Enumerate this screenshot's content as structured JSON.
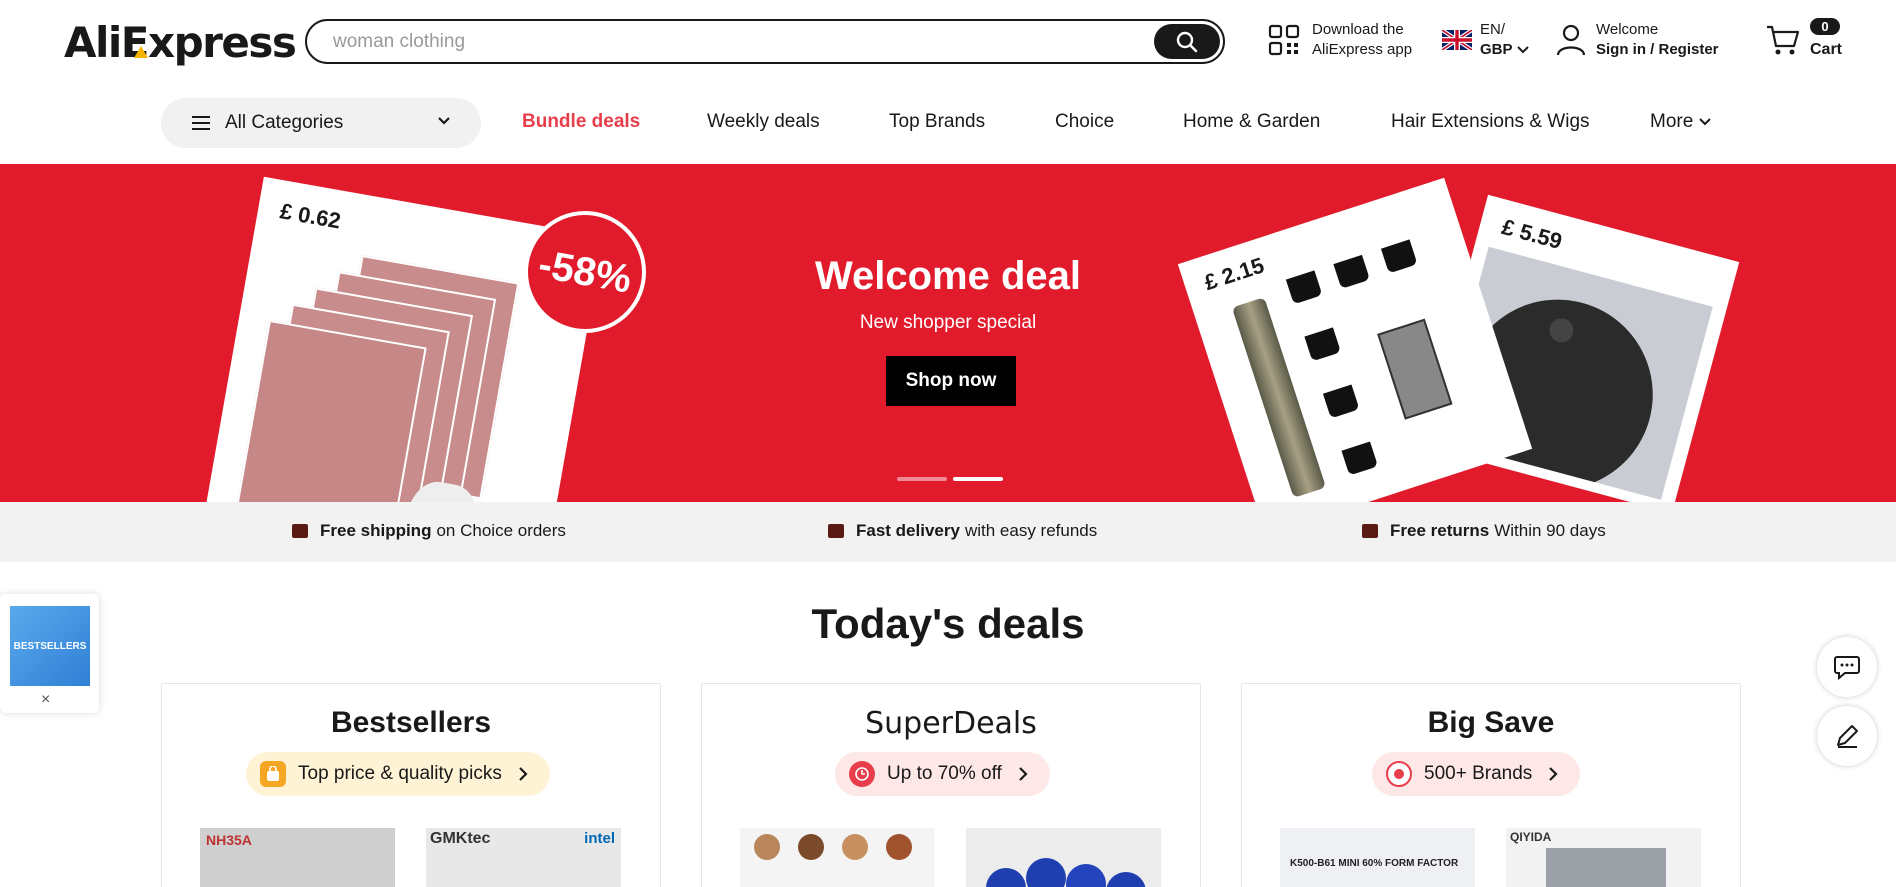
{
  "header": {
    "logo": "AliExpress",
    "search_placeholder": "woman clothing",
    "app_line1": "Download the",
    "app_line2": "AliExpress app",
    "lang_line1": "EN/",
    "lang_line2": "GBP",
    "user_line1": "Welcome",
    "user_line2": "Sign in / Register",
    "cart_count": "0",
    "cart_label": "Cart"
  },
  "nav": {
    "all_categories": "All Categories",
    "links": [
      "Bundle deals",
      "Weekly deals",
      "Top Brands",
      "Choice",
      "Home & Garden",
      "Hair Extensions & Wigs",
      "More"
    ]
  },
  "banner": {
    "title": "Welcome deal",
    "subtitle": "New shopper special",
    "cta": "Shop now",
    "discount": "-58%",
    "prices": [
      "£ 0.62",
      "£ 2.15",
      "£ 5.59"
    ],
    "colors": {
      "background": "#e21b2c",
      "dot_inactive": "#f08a94",
      "dot_active": "#ffffff"
    }
  },
  "benefits": [
    {
      "bold": "Free shipping",
      "text": "on Choice orders"
    },
    {
      "bold": "Fast delivery",
      "text": "with easy refunds"
    },
    {
      "bold": "Free returns",
      "text": "Within 90 days"
    }
  ],
  "deals": {
    "title": "Today's deals",
    "cards": [
      {
        "title": "Bestsellers",
        "pill": "Top price & quality picks",
        "thumb_labels": [
          "NH35A",
          "GMKtec"
        ]
      },
      {
        "title": "SuperDeals",
        "pill": "Up to 70% off",
        "thumb_labels": [
          "",
          ""
        ]
      },
      {
        "title": "Big Save",
        "pill": "500+ Brands",
        "thumb_labels": [
          "K500-B61 MINI 60% FORM FACTOR",
          "QIYIDA"
        ]
      }
    ]
  },
  "floating": {
    "bestsellers_label": "BESTSELLERS",
    "close": "×"
  }
}
